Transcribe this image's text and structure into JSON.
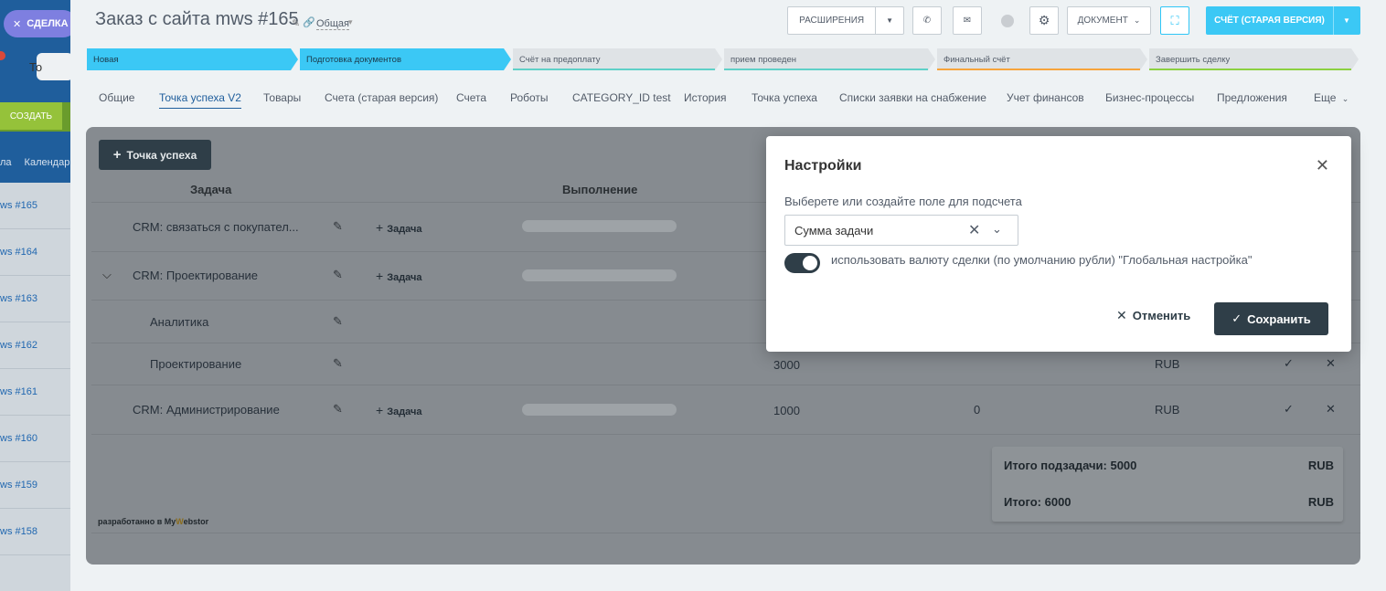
{
  "left_strip": {
    "deal_label": "СДЕЛКА",
    "to_label": "То",
    "create_label": "СОЗДАТЬ",
    "tab_row": [
      "ла",
      "Календар"
    ],
    "deal_links": [
      "ws #165",
      "ws #164",
      "ws #163",
      "ws #162",
      "ws #161",
      "ws #160",
      "ws #159",
      "ws #158"
    ]
  },
  "header": {
    "title": "Заказ с сайта mws #165",
    "category": "Общая",
    "extensions_label": "РАСШИРЕНИЯ",
    "document_label": "ДОКУМЕНТ",
    "invoice_label": "СЧЁТ (СТАРАЯ ВЕРСИЯ)"
  },
  "stages": [
    {
      "label": "Новая",
      "state": "active",
      "underline": ""
    },
    {
      "label": "Подготовка документов",
      "state": "active",
      "underline": ""
    },
    {
      "label": "Счёт на предоплату",
      "state": "pending",
      "underline": "#5fd0c8"
    },
    {
      "label": "прием проведен",
      "state": "pending",
      "underline": "#5fd0c8"
    },
    {
      "label": "Финальный счёт",
      "state": "pending",
      "underline": "#f7a43b"
    },
    {
      "label": "Завершить сделку",
      "state": "pending",
      "underline": "#8cd040"
    }
  ],
  "tabs": [
    {
      "label": "Общие",
      "active": false
    },
    {
      "label": "Точка успеха V2",
      "active": true
    },
    {
      "label": "Товары",
      "active": false
    },
    {
      "label": "Счета (старая версия)",
      "active": false
    },
    {
      "label": "Счета",
      "active": false
    },
    {
      "label": "Роботы",
      "active": false
    },
    {
      "label": "CATEGORY_ID test",
      "active": false
    },
    {
      "label": "История",
      "active": false
    },
    {
      "label": "Точка успеха",
      "active": false
    },
    {
      "label": "Списки заявки на снабжение",
      "active": false
    },
    {
      "label": "Учет финансов",
      "active": false
    },
    {
      "label": "Бизнес-процессы",
      "active": false
    },
    {
      "label": "Предложения",
      "active": false
    },
    {
      "label": "Еще",
      "active": false
    }
  ],
  "panel": {
    "add_button": "Точка успеха",
    "col_task": "Задача",
    "col_exec": "Выполнение",
    "add_task": "Задача",
    "rows": [
      {
        "name": "CRM: связаться с покупател...",
        "amount": "",
        "count": "",
        "currency": ""
      },
      {
        "name": "CRM: Проектирование",
        "amount": "",
        "count": "",
        "currency": ""
      },
      {
        "name": "Аналитика",
        "amount": "",
        "count": "",
        "currency": ""
      },
      {
        "name": "Проектирование",
        "amount": "3000",
        "count": "",
        "currency": "RUB"
      },
      {
        "name": "CRM: Администрирование",
        "amount": "1000",
        "count": "0",
        "currency": "RUB"
      }
    ],
    "subtotal_label": "Итого подзадачи: 5000",
    "total_label": "Итого: 6000",
    "currency": "RUB",
    "credit_prefix": "разработанно в My",
    "credit_w": "W",
    "credit_suffix": "ebstor"
  },
  "modal": {
    "title": "Настройки",
    "field_label": "Выберете или создайте поле для подсчета",
    "select_value": "Сумма задачи",
    "toggle_on": true,
    "toggle_label": "использовать валюту сделки (по умолчанию рубли) \"Глобальная настройка\"",
    "cancel_label": "Отменить",
    "save_label": "Сохранить"
  }
}
